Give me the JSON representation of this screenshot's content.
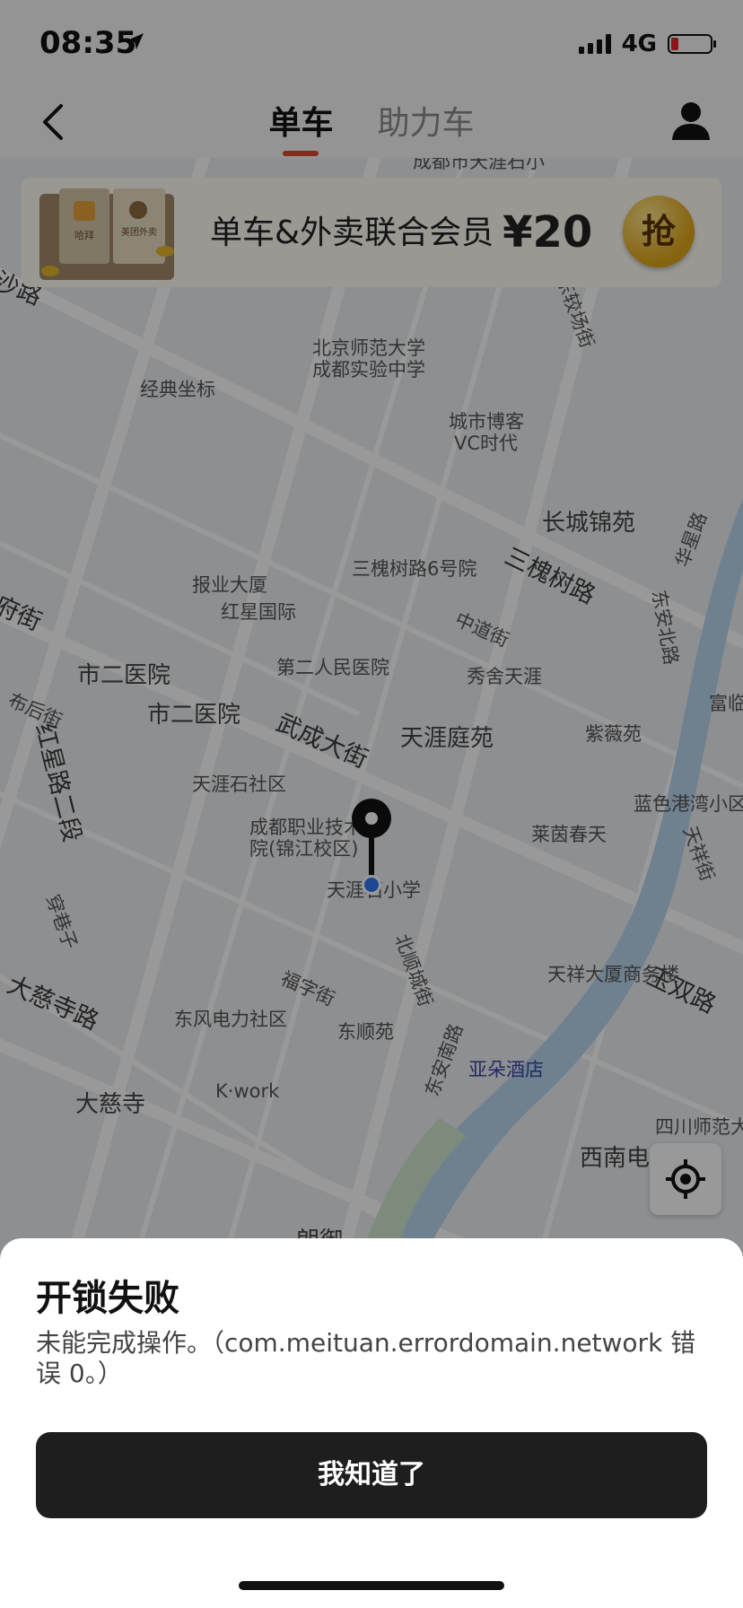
{
  "status_bar": {
    "time": "08:35",
    "network": "4G"
  },
  "header": {
    "tabs": [
      {
        "label": "单车",
        "active": true
      },
      {
        "label": "助力车",
        "active": false
      }
    ]
  },
  "banner": {
    "text": "单车&外卖联合会员",
    "price": "¥20",
    "button": "抢",
    "box_labels": [
      "哈拜",
      "美团外卖"
    ]
  },
  "map": {
    "labels": [
      "成都市天涯石小",
      "沙路",
      "北京师范大学",
      "成都实验中学",
      "经典坐标",
      "东较场街",
      "城市博客",
      "VC时代",
      "长城锦苑",
      "三槐树路6号院",
      "三槐树路",
      "华星路",
      "报业大厦",
      "红星国际",
      "府街",
      "中道街",
      "东安北路",
      "市二医院",
      "第二人民医院",
      "秀舍天涯",
      "市二医院",
      "布后街",
      "紫薇苑",
      "富临",
      "武成大街",
      "天涯庭苑",
      "红星路二段",
      "天涯石社区",
      "成都职业技术学院(锦江校区)",
      "蓝色港湾小区",
      "莱茵春天",
      "天祥街",
      "天涯石小学",
      "穿巷子",
      "北顺城街",
      "玉双路",
      "福字街",
      "天祥大厦商务楼",
      "大慈寺路",
      "东风电力社区",
      "东顺苑",
      "东安南路",
      "亚朵酒店",
      "四川师范大学",
      "大慈寺",
      "K·work",
      "西南电力设",
      "朗御"
    ]
  },
  "dialog": {
    "title": "开锁失败",
    "message": "未能完成操作。（com.meituan.errordomain.network 错误 0。）",
    "button": "我知道了"
  },
  "colors": {
    "accent": "#e04a2f",
    "button_dark": "#1e1e1e",
    "overlay": "rgba(0,0,0,0.40)"
  }
}
